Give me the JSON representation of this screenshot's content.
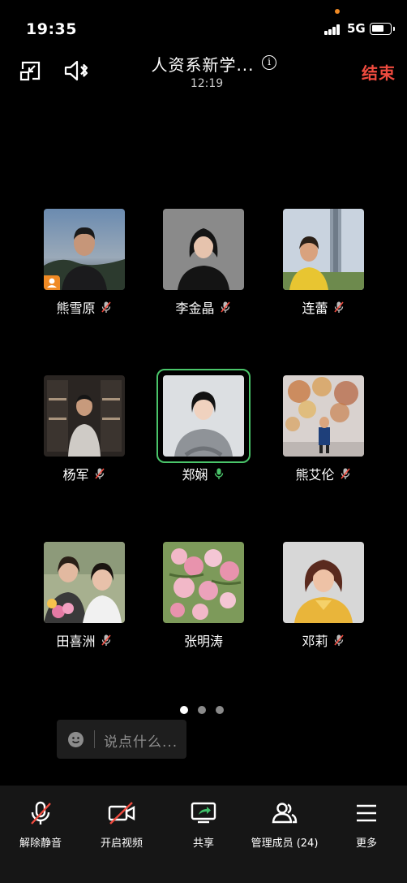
{
  "status_bar": {
    "time": "19:35",
    "network": "5G"
  },
  "header": {
    "title": "人资系新学...",
    "duration": "12:19",
    "end_label": "结束"
  },
  "participants": [
    {
      "name": "熊雪原",
      "mic": "muted",
      "host": true
    },
    {
      "name": "李金晶",
      "mic": "muted"
    },
    {
      "name": "连蕾",
      "mic": "muted"
    },
    {
      "name": "杨军",
      "mic": "muted"
    },
    {
      "name": "郑娴",
      "mic": "speaking"
    },
    {
      "name": "熊艾伦",
      "mic": "muted"
    },
    {
      "name": "田喜洲",
      "mic": "muted"
    },
    {
      "name": "张明涛",
      "mic": "none"
    },
    {
      "name": "邓莉",
      "mic": "muted"
    }
  ],
  "pager": {
    "pages": 3,
    "current": 1
  },
  "chat": {
    "placeholder": "说点什么..."
  },
  "toolbar": {
    "unmute": "解除静音",
    "video": "开启视频",
    "share": "共享",
    "members": "管理成员 (24)",
    "more": "更多"
  },
  "colors": {
    "end": "#f04b3f",
    "speaking": "#4ac56a",
    "host_badge": "#f08a24"
  }
}
